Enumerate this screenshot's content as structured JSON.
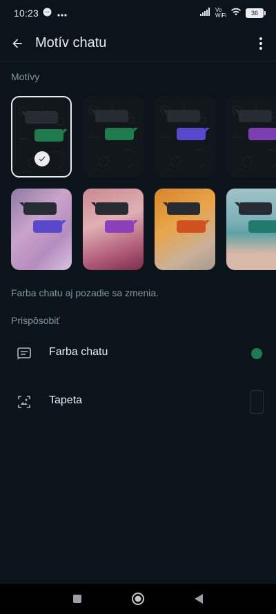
{
  "status": {
    "time": "10:23",
    "vowifi_top": "Vo",
    "vowifi_bottom": "WiFi",
    "battery": "36"
  },
  "appbar": {
    "title": "Motív chatu"
  },
  "themes": {
    "section_title": "Motívy",
    "dark_tiles": [
      {
        "accent": "#1f7a4d",
        "selected": true
      },
      {
        "accent": "#1f7a4d",
        "selected": false
      },
      {
        "accent": "#5a48cc",
        "selected": false
      },
      {
        "accent": "#7b3fb0",
        "selected": false
      }
    ],
    "image_tiles": [
      {
        "accent": "#5a48cc",
        "bg": "linear-gradient(135deg,#8e7aa6,#c9a3c8 40%,#b48dc0 70%,#d9c2df)"
      },
      {
        "accent": "#8c3fb8",
        "bg": "linear-gradient(160deg,#c9898f,#e0b0b4 40%,#b05b78 75%,#7a2e4e)"
      },
      {
        "accent": "#d0511e",
        "bg": "linear-gradient(150deg,#d9852a,#e8a54a 40%,#c9b09a 75%,#a49a8f)"
      },
      {
        "accent": "#1f7a6d",
        "bg": "linear-gradient(180deg,#9fc2c9,#7eb1b8 40%,#5fa3a6 55%,#d8b8a8 80%)"
      }
    ]
  },
  "note": "Farba chatu aj pozadie sa zmenia.",
  "customize": {
    "section_title": "Prispôsobiť",
    "chat_color_label": "Farba chatu",
    "chat_color_value": "#1f7a4d",
    "wallpaper_label": "Tapeta"
  }
}
